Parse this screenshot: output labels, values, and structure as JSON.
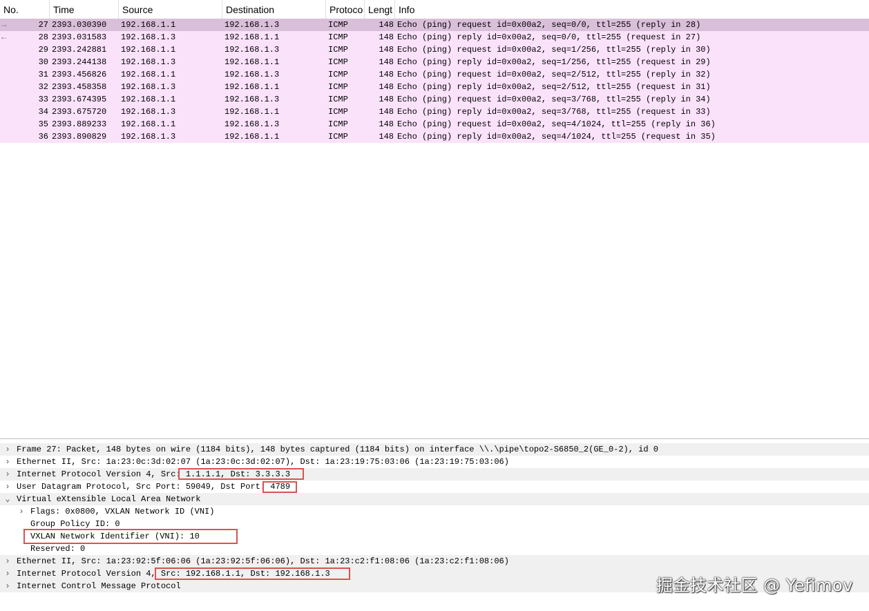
{
  "packet_list": {
    "columns": [
      "No.",
      "Time",
      "Source",
      "Destination",
      "Protoco",
      "Lengt",
      "Info"
    ],
    "rows": [
      {
        "arrow": "→",
        "no": "27",
        "time": "2393.030390",
        "source": "192.168.1.1",
        "destination": "192.168.1.3",
        "protocol": "ICMP",
        "length": "148",
        "info": "Echo (ping) request  id=0x00a2, seq=0/0, ttl=255 (reply in 28)",
        "selected": true
      },
      {
        "arrow": "←",
        "no": "28",
        "time": "2393.031583",
        "source": "192.168.1.3",
        "destination": "192.168.1.1",
        "protocol": "ICMP",
        "length": "148",
        "info": "Echo (ping) reply    id=0x00a2, seq=0/0, ttl=255 (request in 27)"
      },
      {
        "arrow": "",
        "no": "29",
        "time": "2393.242881",
        "source": "192.168.1.1",
        "destination": "192.168.1.3",
        "protocol": "ICMP",
        "length": "148",
        "info": "Echo (ping) request  id=0x00a2, seq=1/256, ttl=255 (reply in 30)"
      },
      {
        "arrow": "",
        "no": "30",
        "time": "2393.244138",
        "source": "192.168.1.3",
        "destination": "192.168.1.1",
        "protocol": "ICMP",
        "length": "148",
        "info": "Echo (ping) reply    id=0x00a2, seq=1/256, ttl=255 (request in 29)"
      },
      {
        "arrow": "",
        "no": "31",
        "time": "2393.456826",
        "source": "192.168.1.1",
        "destination": "192.168.1.3",
        "protocol": "ICMP",
        "length": "148",
        "info": "Echo (ping) request  id=0x00a2, seq=2/512, ttl=255 (reply in 32)"
      },
      {
        "arrow": "",
        "no": "32",
        "time": "2393.458358",
        "source": "192.168.1.3",
        "destination": "192.168.1.1",
        "protocol": "ICMP",
        "length": "148",
        "info": "Echo (ping) reply    id=0x00a2, seq=2/512, ttl=255 (request in 31)"
      },
      {
        "arrow": "",
        "no": "33",
        "time": "2393.674395",
        "source": "192.168.1.1",
        "destination": "192.168.1.3",
        "protocol": "ICMP",
        "length": "148",
        "info": "Echo (ping) request  id=0x00a2, seq=3/768, ttl=255 (reply in 34)"
      },
      {
        "arrow": "",
        "no": "34",
        "time": "2393.675720",
        "source": "192.168.1.3",
        "destination": "192.168.1.1",
        "protocol": "ICMP",
        "length": "148",
        "info": "Echo (ping) reply    id=0x00a2, seq=3/768, ttl=255 (request in 33)"
      },
      {
        "arrow": "",
        "no": "35",
        "time": "2393.889233",
        "source": "192.168.1.1",
        "destination": "192.168.1.3",
        "protocol": "ICMP",
        "length": "148",
        "info": "Echo (ping) request  id=0x00a2, seq=4/1024, ttl=255 (reply in 36)"
      },
      {
        "arrow": "",
        "no": "36",
        "time": "2393.890829",
        "source": "192.168.1.3",
        "destination": "192.168.1.1",
        "protocol": "ICMP",
        "length": "148",
        "info": "Echo (ping) reply    id=0x00a2, seq=4/1024, ttl=255 (request in 35)"
      }
    ]
  },
  "details": {
    "lines": [
      {
        "chevron": "›",
        "text": "Frame 27: Packet, 148 bytes on wire (1184 bits), 148 bytes captured (1184 bits) on interface \\\\.\\pipe\\topo2-S6850_2(GE_0-2), id 0",
        "shaded": true
      },
      {
        "chevron": "›",
        "text": "Ethernet II, Src: 1a:23:0c:3d:02:07 (1a:23:0c:3d:02:07), Dst: 1a:23:19:75:03:06 (1a:23:19:75:03:06)",
        "shaded": false
      },
      {
        "chevron": "›",
        "text": "Internet Protocol Version 4, Src: 1.1.1.1, Dst: 3.3.3.3",
        "shaded": true
      },
      {
        "chevron": "›",
        "text": "User Datagram Protocol, Src Port: 59049, Dst Port: 4789",
        "shaded": false
      },
      {
        "chevron": "⌄",
        "text": "Virtual eXtensible Local Area Network",
        "shaded": true
      },
      {
        "chevron": "›",
        "text": "Flags: 0x0800, VXLAN Network ID (VNI)",
        "shaded": false,
        "indent": 1
      },
      {
        "chevron": "",
        "text": "Group Policy ID: 0",
        "shaded": false,
        "indent": 1
      },
      {
        "chevron": "",
        "text": "VXLAN Network Identifier (VNI): 10",
        "shaded": false,
        "indent": 1
      },
      {
        "chevron": "",
        "text": "Reserved: 0",
        "shaded": false,
        "indent": 1
      },
      {
        "chevron": "›",
        "text": "Ethernet II, Src: 1a:23:92:5f:06:06 (1a:23:92:5f:06:06), Dst: 1a:23:c2:f1:08:06 (1a:23:c2:f1:08:06)",
        "shaded": true
      },
      {
        "chevron": "›",
        "text": "Internet Protocol Version 4, Src: 192.168.1.1, Dst: 192.168.1.3",
        "shaded": true
      },
      {
        "chevron": "›",
        "text": "Internet Control Message Protocol",
        "shaded": true
      }
    ]
  },
  "watermark": "掘金技术社区 @ Yefimov",
  "colors": {
    "row_bg": "#fbe2fb",
    "row_selected_bg": "#d9bfd9",
    "highlight_box": "#d9534f"
  }
}
